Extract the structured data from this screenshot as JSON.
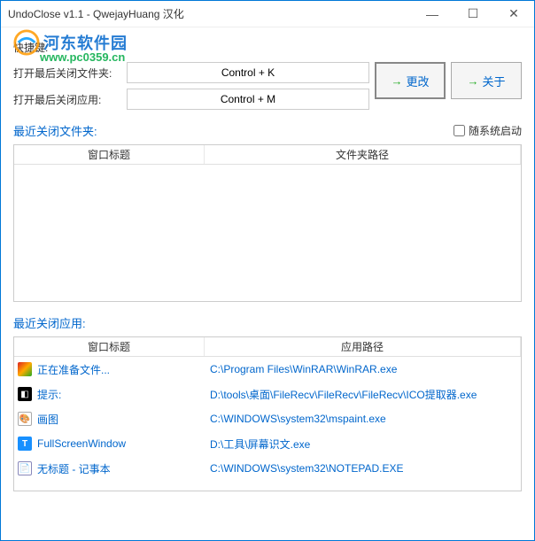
{
  "window": {
    "title": "UndoClose v1.1 - QwejayHuang 汉化"
  },
  "watermark": {
    "title": "河东软件园",
    "url": "www.pc0359.cn"
  },
  "hotkeys": {
    "section_label": "快捷键:",
    "row_folder_label": "打开最后关闭文件夹:",
    "row_folder_value": "Control + K",
    "row_app_label": "打开最后关闭应用:",
    "row_app_value": "Control + M",
    "change_btn": "更改",
    "about_btn": "关于"
  },
  "folders": {
    "header": "最近关闭文件夹:",
    "autostart_label": "随系统启动",
    "col1": "窗口标题",
    "col2": "文件夹路径",
    "rows": []
  },
  "apps": {
    "header": "最近关闭应用:",
    "col1": "窗口标题",
    "col2": "应用路径",
    "rows": [
      {
        "icon": "ic-winrar",
        "title": "正在准备文件...",
        "path": "C:\\Program Files\\WinRAR\\WinRAR.exe"
      },
      {
        "icon": "ic-ico",
        "title": "提示:",
        "path": "D:\\tools\\桌面\\FileRecv\\FileRecv\\FileRecv\\ICO提取器.exe"
      },
      {
        "icon": "ic-paint",
        "title": "画图",
        "path": "C:\\WINDOWS\\system32\\mspaint.exe"
      },
      {
        "icon": "ic-fs",
        "title": "FullScreenWindow",
        "path": "D:\\工具\\屏幕识文.exe"
      },
      {
        "icon": "ic-notepad",
        "title": "无标题 - 记事本",
        "path": "C:\\WINDOWS\\system32\\NOTEPAD.EXE"
      }
    ]
  }
}
